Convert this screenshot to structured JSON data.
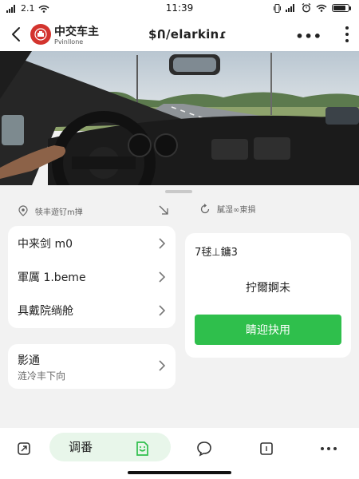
{
  "status_bar": {
    "carrier_signal": "2.1",
    "time": "11:39",
    "accent": "#222222"
  },
  "header": {
    "brand_name": "中交车主",
    "brand_sub": "Pvinllone",
    "title": "$Ո/elarkinɾ",
    "more_label": "•••",
    "logo_color": "#d3342e"
  },
  "left_section": {
    "header_label": "犊丰遊钌m掸",
    "list": [
      {
        "label": "中来剑 m0"
      },
      {
        "label": "軍厲 1.beme"
      },
      {
        "label": "具戴院绱舱"
      }
    ],
    "sub_card": {
      "title": "影通",
      "desc": "涟冷丰下向"
    }
  },
  "right_section": {
    "header_label": "膩湿∞東損",
    "code_text": "7毬⊥鏞3",
    "status_text": "拧爾婀未",
    "button_label": "睛迎抉用",
    "button_color": "#2fbf4c"
  },
  "bottom_nav": {
    "active_label": "调番",
    "items": [
      {
        "icon": "phone-rotate-icon"
      },
      {
        "icon": "document-smile-icon"
      },
      {
        "icon": "chat-bubble-icon"
      },
      {
        "icon": "square-box-icon"
      },
      {
        "icon": "more-dots-icon"
      }
    ],
    "active_color": "#2fbf4c"
  }
}
